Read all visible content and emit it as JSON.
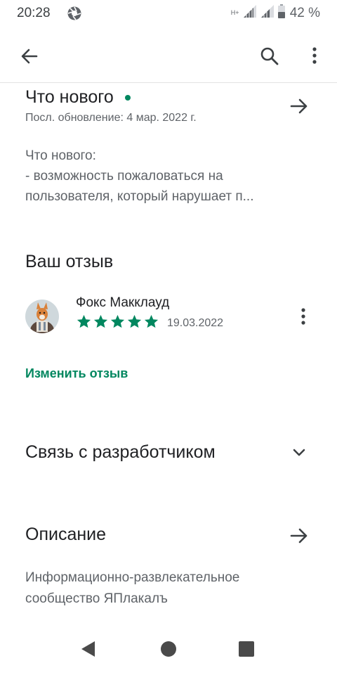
{
  "status_bar": {
    "time": "20:28",
    "network_type": "H+",
    "battery_percent": "42 %"
  },
  "app_bar": {
    "icons": [
      "back-arrow-icon",
      "search-icon",
      "more-vert-icon"
    ]
  },
  "whats_new": {
    "title": "Что нового",
    "last_update": "Посл. обновление: 4 мар. 2022 г.",
    "text_lines": [
      "Что нового:",
      "- возможность пожаловаться на",
      "пользователя, который нарушает п..."
    ],
    "dot_color": "#01875f"
  },
  "your_review": {
    "title": "Ваш отзыв",
    "reviewer_name": "Фокс Макклауд",
    "rating": 5,
    "rating_max": 5,
    "date": "19.03.2022",
    "edit_label": "Изменить отзыв",
    "accent_color": "#01875f"
  },
  "contact_developer": {
    "title": "Связь с разработчиком"
  },
  "description": {
    "title": "Описание",
    "text": "Информационно-развлекательное сообщество ЯПлакалъ"
  },
  "nav_bar": {
    "icons": [
      "nav-back-icon",
      "nav-home-icon",
      "nav-recents-icon"
    ]
  }
}
